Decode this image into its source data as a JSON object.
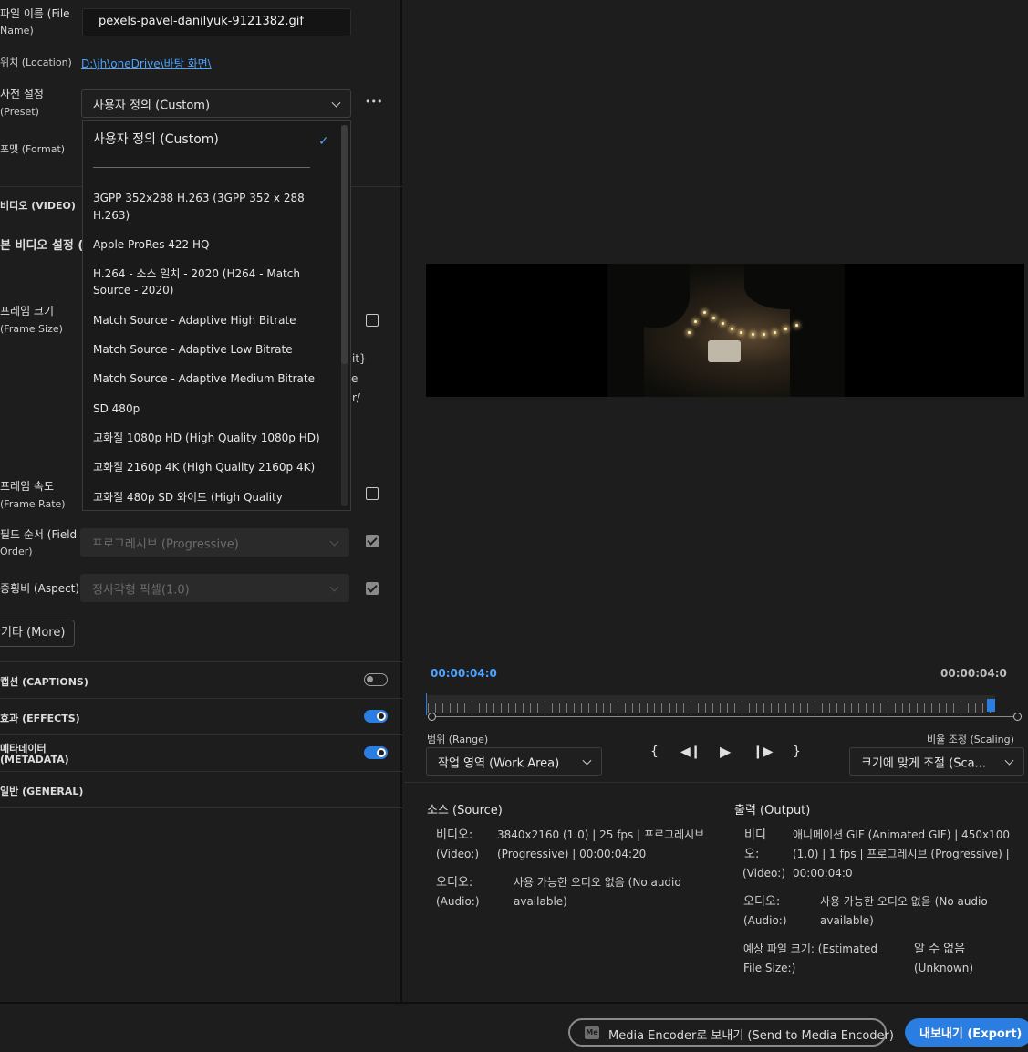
{
  "left": {
    "file_name_label": "파일 이름 (File",
    "file_name_label2": "Name)",
    "file_name_value": "pexels-pavel-danilyuk-9121382.gif",
    "location_label": "위치 (Location)",
    "location_value": "D:\\jh\\oneDrive\\바탕 화면\\",
    "preset_label": "사전 설정",
    "preset_label2": "(Preset)",
    "preset_value": "사용자 정의 (Custom)",
    "preset_more": "•••",
    "format_label": "포맷 (Format)",
    "video_section": "비디오 (VIDEO)",
    "basic_video_settings": "본 비디오 설정 (",
    "frame_size_label": "프레임 크기",
    "frame_size_label2": "(Frame Size)",
    "overflow_1": "it}",
    "overflow_2": "e",
    "overflow_3": "r/",
    "frame_rate_label": "프레임 속도",
    "frame_rate_label2": "(Frame Rate)",
    "field_order_label": "필드 순서 (Field",
    "field_order_label2": "Order)",
    "field_order_value": "프로그레시브 (Progressive)",
    "aspect_label": "종횡비 (Aspect)",
    "aspect_value": "정사각형 픽셀(1.0)",
    "more_button": "기타 (More)",
    "captions": "캡션 (CAPTIONS)",
    "effects": "효과 (EFFECTS)",
    "metadata_1": "메타데이터",
    "metadata_2": "(METADATA)",
    "general": "일반 (GENERAL)",
    "captions_on": false,
    "effects_on": true,
    "metadata_on": true,
    "frame_size_checked": false,
    "frame_rate_checked": false,
    "field_order_checked": true,
    "aspect_checked": true
  },
  "dropdown": {
    "selected": "사용자 정의 (Custom)",
    "check": "✓",
    "items": [
      "3GPP 352x288 H.263 (3GPP 352 x 288",
      "H.263)",
      "Apple ProRes 422 HQ",
      "H.264 - 소스 일치 - 2020 (H264 - Match",
      "Source - 2020)",
      "Match Source - Adaptive High Bitrate",
      "Match Source - Adaptive Low Bitrate",
      "Match Source - Adaptive Medium Bitrate",
      "SD 480p",
      "고화질 1080p HD (High Quality 1080p HD)",
      "고화질 2160p 4K (High Quality 2160p 4K)",
      "고화질 480p SD 와이드 (High Quality"
    ]
  },
  "right": {
    "time_start": "00:00:04:0",
    "time_end": "00:00:04:0",
    "range_label": "범위 (Range)",
    "range_value": "작업 영역 (Work Area)",
    "scaling_label": "비율 조정 (Scaling)",
    "scaling_value": "크기에 맞게 조절 (Sca...",
    "controls": {
      "in": "{",
      "step_back": "◀❙",
      "play": "▶",
      "step_fwd": "❙▶",
      "out": "}"
    },
    "source_title": "소스 (Source)",
    "source_video_label1": "비디오:",
    "source_video_label2": "(Video:)",
    "source_video_line1": "3840x2160 (1.0) | 25 fps | 프로그레시브",
    "source_video_line2": "(Progressive) | 00:00:04:20",
    "source_audio_label1": "오디오:",
    "source_audio_label2": "(Audio:)",
    "source_audio_line1": "사용 가능한 오디오 없음 (No audio",
    "source_audio_line2": "available)",
    "output_title": "출력 (Output)",
    "output_video_label1": "비디",
    "output_video_label2": "오:",
    "output_video_label3": "(Video:)",
    "output_video_line1": "애니메이션 GIF (Animated GIF) | 450x100",
    "output_video_line2": "(1.0) | 1 fps | 프로그레시브 (Progressive) |",
    "output_video_line3": "00:00:04:0",
    "output_audio_label1": "오디오:",
    "output_audio_label2": "(Audio:)",
    "output_audio_line1": "사용 가능한 오디오 없음 (No audio",
    "output_audio_line2": "available)",
    "est_size_label1": "예상 파일 크기: (Estimated",
    "est_size_label2": "File Size:)",
    "est_size_value1": "알 수 없음",
    "est_size_value2": "(Unknown)"
  },
  "footer": {
    "me_icon": "Me",
    "send_label": "Media Encoder로 보내기 (Send to Media Encoder)",
    "export_label": "내보내기 (Export)"
  },
  "colors": {
    "accent": "#2a7de1",
    "link": "#4da3ff",
    "background": "#1d1d1d"
  }
}
